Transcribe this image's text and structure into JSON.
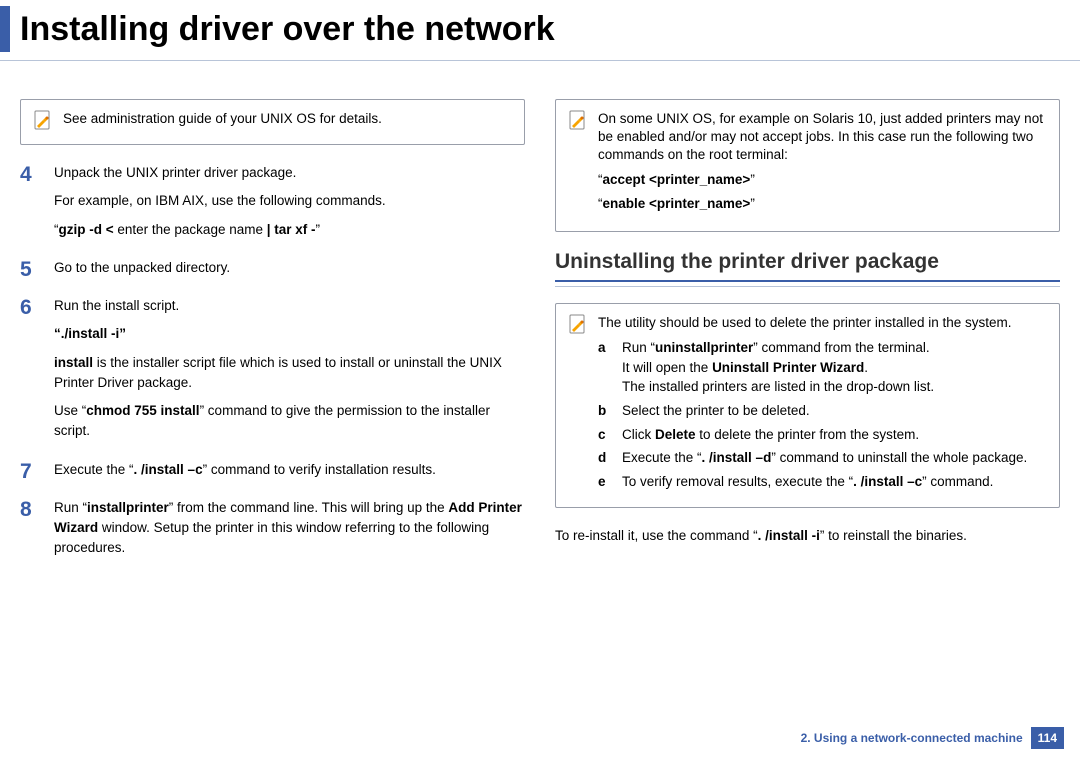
{
  "header": {
    "title": "Installing driver over the network"
  },
  "left": {
    "note1": "See administration guide of your UNIX OS for details.",
    "step4": {
      "num": "4",
      "p1": "Unpack the UNIX printer driver package.",
      "p2": "For example, on IBM AIX, use the following commands.",
      "cmd_pre": "“",
      "cmd_b1": "gzip -d <",
      "cmd_mid": " enter the package name ",
      "cmd_b2": "| tar xf -",
      "cmd_post": "”"
    },
    "step5": {
      "num": "5",
      "p1": "Go to the unpacked directory."
    },
    "step6": {
      "num": "6",
      "p1": "Run the install script.",
      "cmd": "“./install -i”",
      "p2a": "install",
      "p2b": " is the installer script file which is used to install or uninstall the UNIX Printer Driver package.",
      "p3a": "Use “",
      "p3b": "chmod 755 install",
      "p3c": "” command to give the permission to the installer script."
    },
    "step7": {
      "num": "7",
      "p1a": "Execute the “",
      "p1b": ". /install –c",
      "p1c": "” command to verify installation results."
    },
    "step8": {
      "num": "8",
      "p1a": "Run “",
      "p1b": "installprinter",
      "p1c": "” from the command line. This will bring up the ",
      "p1d": "Add Printer Wizard",
      "p1e": " window. Setup the printer in this window referring to the following procedures."
    }
  },
  "right": {
    "note1": {
      "p1": "On some UNIX OS, for example on Solaris 10, just added printers may not be enabled and/or may not accept jobs. In this case run the following two commands on the root terminal:",
      "cmd1_q1": "“",
      "cmd1_b": "accept <printer_name>",
      "cmd1_q2": "”",
      "cmd2_q1": "“",
      "cmd2_b": "enable <printer_name>",
      "cmd2_q2": "”"
    },
    "section_title": "Uninstalling the printer driver package",
    "note2": {
      "p1": "The utility should be used to delete the printer installed in the system.",
      "a1": "Run “",
      "a1b": "uninstallprinter",
      "a1c": "” command from the terminal.",
      "a2a": "It will open the ",
      "a2b": "Uninstall Printer Wizard",
      "a2c": ".",
      "a3": "The installed printers are listed in the drop-down list.",
      "b": "Select the printer to be deleted.",
      "c1": "Click ",
      "c2": "Delete",
      "c3": " to delete the printer from the system.",
      "d1": "Execute the “",
      "d2": ". /install –d",
      "d3": "” command to uninstall the whole package.",
      "e1": "To verify removal results, execute the “",
      "e2": ". /install –c",
      "e3": "” command."
    },
    "para1a": "To re-install it, use the command “",
    "para1b": ". /install -i",
    "para1c": "” to reinstall the binaries."
  },
  "footer": {
    "chapter": "2.  Using a network-connected machine",
    "page": "114"
  }
}
